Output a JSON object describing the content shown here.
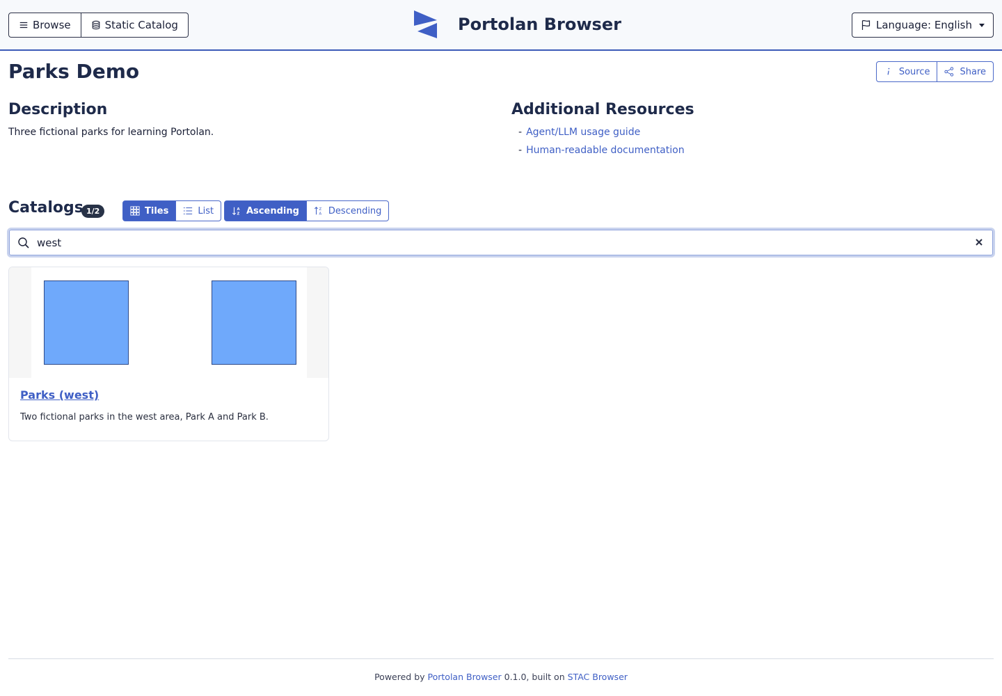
{
  "header": {
    "browse_label": "Browse",
    "static_catalog_label": "Static Catalog",
    "brand_title": "Portolan Browser",
    "language_label": "Language: English"
  },
  "page": {
    "title": "Parks Demo",
    "source_label": "Source",
    "share_label": "Share"
  },
  "description": {
    "heading": "Description",
    "text": "Three fictional parks for learning Portolan."
  },
  "resources": {
    "heading": "Additional Resources",
    "items": [
      {
        "bullet": "-",
        "label": "Agent/LLM usage guide"
      },
      {
        "bullet": "-",
        "label": "Human-readable documentation"
      }
    ]
  },
  "catalogs": {
    "heading": "Catalogs",
    "count_badge": "1/2",
    "view_tiles": "Tiles",
    "view_list": "List",
    "sort_ascending": "Ascending",
    "sort_descending": "Descending",
    "search_value": "west",
    "cards": [
      {
        "title": "Parks (west)",
        "description": "Two fictional parks in the west area, Park A and Park B."
      }
    ]
  },
  "footer": {
    "prefix": "Powered by ",
    "link1": "Portolan Browser",
    "middle": " 0.1.0, built on ",
    "link2": "STAC Browser"
  },
  "colors": {
    "accent": "#3f5fc5",
    "header_border": "#3c5bb8",
    "park_fill": "#6fa9fb",
    "badge_bg": "#283247"
  },
  "icons": {
    "browse": "menu-icon",
    "static_catalog": "database-icon",
    "language": "flag-icon",
    "source": "info-icon",
    "share": "share-icon",
    "tiles": "grid-icon",
    "list": "list-icon",
    "ascending": "sort-ascending-icon",
    "descending": "sort-descending-icon",
    "search": "search-icon",
    "clear": "close-icon"
  }
}
